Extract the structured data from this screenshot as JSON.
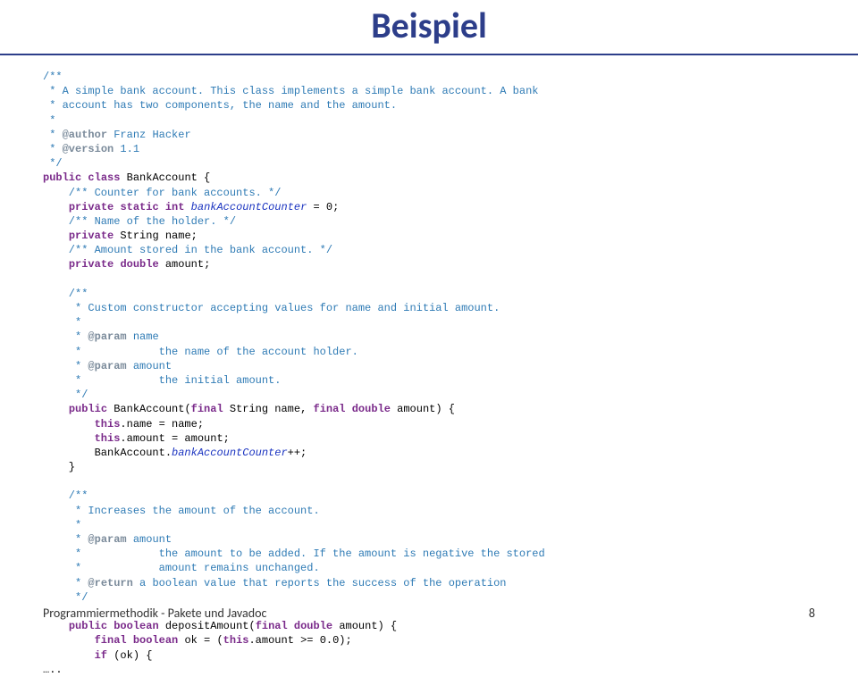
{
  "title": "Beispiel",
  "code": {
    "l1": "/**",
    "l2": " * A simple bank account. This class implements a simple bank account. A bank",
    "l3": " * account has two components, the name and the amount.",
    "l4": " *",
    "l5a": " * ",
    "l5tag": "@author",
    "l5b": " Franz Hacker",
    "l6a": " * ",
    "l6tag": "@version",
    "l6b": " 1.1",
    "l7": " */",
    "l8kw1": "public",
    "l8sp1": " ",
    "l8kw2": "class",
    "l8txt": " BankAccount {",
    "l9c": "    /** Counter for bank accounts. */",
    "l10a": "    ",
    "l10kw1": "private",
    "l10sp": " ",
    "l10kw2": "static",
    "l10sp2": " ",
    "l10kw3": "int",
    "l10sp3": " ",
    "l10it": "bankAccountCounter",
    "l10b": " = 0;",
    "l11c": "    /** Name of the holder. */",
    "l12a": "    ",
    "l12kw": "private",
    "l12b": " String name;",
    "l13c": "    /** Amount stored in the bank account. */",
    "l14a": "    ",
    "l14kw1": "private",
    "l14sp": " ",
    "l14kw2": "double",
    "l14b": " amount;",
    "l15": "",
    "l16": "    /**",
    "l17": "     * Custom constructor accepting values for name and initial amount.",
    "l18": "     *",
    "l19a": "     * ",
    "l19tag": "@param",
    "l19b": " name",
    "l20": "     *            the name of the account holder.",
    "l21a": "     * ",
    "l21tag": "@param",
    "l21b": " amount",
    "l22": "     *            the initial amount.",
    "l23": "     */",
    "l24a": "    ",
    "l24kw1": "public",
    "l24b": " BankAccount(",
    "l24kw2": "final",
    "l24c": " String name, ",
    "l24kw3": "final",
    "l24sp": " ",
    "l24kw4": "double",
    "l24d": " amount) {",
    "l25a": "        ",
    "l25kw": "this",
    "l25b": ".name = name;",
    "l26a": "        ",
    "l26kw": "this",
    "l26b": ".amount = amount;",
    "l27a": "        BankAccount.",
    "l27it": "bankAccountCounter",
    "l27b": "++;",
    "l28": "    }",
    "l29": "",
    "l30": "    /**",
    "l31": "     * Increases the amount of the account.",
    "l32": "     *",
    "l33a": "     * ",
    "l33tag": "@param",
    "l33b": " amount",
    "l34": "     *            the amount to be added. If the amount is negative the stored",
    "l35": "     *            amount remains unchanged.",
    "l36a": "     * ",
    "l36tag": "@return",
    "l36b": " a boolean value that reports the success of the operation",
    "l37": "     */",
    "l38": "",
    "l39a": "    ",
    "l39kw1": "public",
    "l39sp": " ",
    "l39kw2": "boolean",
    "l39b": " depositAmount(",
    "l39kw3": "final",
    "l39sp2": " ",
    "l39kw4": "double",
    "l39c": " amount) {",
    "l40a": "        ",
    "l40kw1": "final",
    "l40sp": " ",
    "l40kw2": "boolean",
    "l40b": " ok = (",
    "l40kw3": "this",
    "l40c": ".amount >= 0.0);",
    "l41a": "        ",
    "l41kw": "if",
    "l41b": " (ok) {",
    "l42": "…..  "
  },
  "footer": {
    "text": "Programmiermethodik - Pakete und Javadoc",
    "page": "8"
  }
}
